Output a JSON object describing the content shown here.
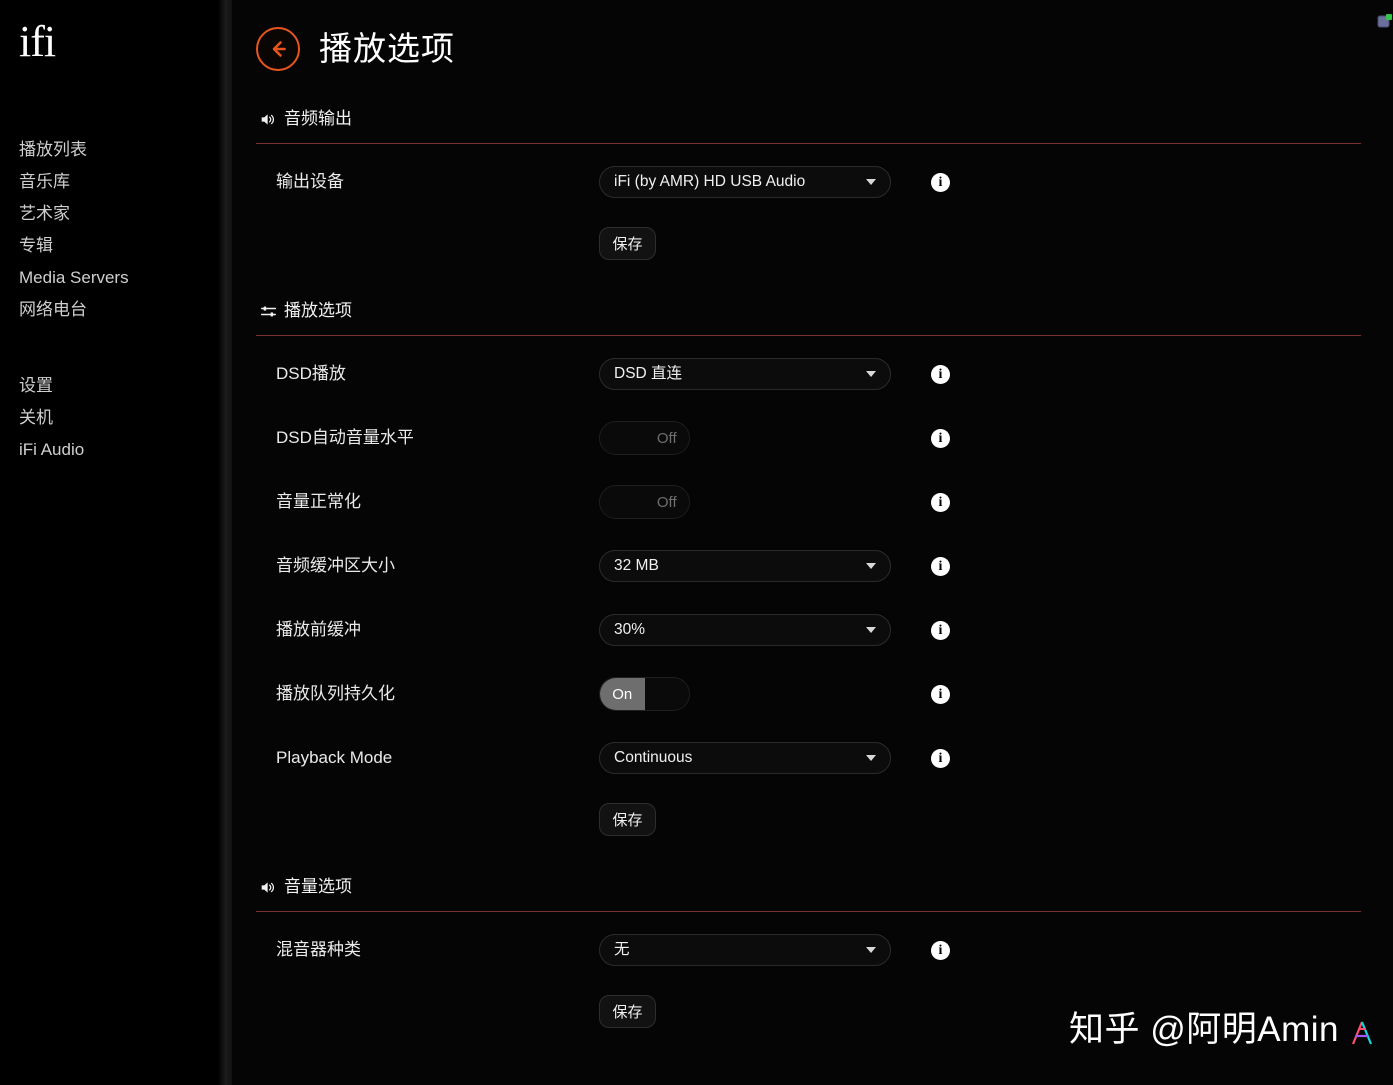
{
  "app": {
    "brand_logo_text": "ifi",
    "accent_color": "#e8551f",
    "rule_color": "#7a3128"
  },
  "sidebar": {
    "primary_items": [
      {
        "label": "播放列表",
        "name": "sidebar-item-playlists"
      },
      {
        "label": "音乐库",
        "name": "sidebar-item-library"
      },
      {
        "label": "艺术家",
        "name": "sidebar-item-artists"
      },
      {
        "label": "专辑",
        "name": "sidebar-item-albums"
      },
      {
        "label": "Media Servers",
        "name": "sidebar-item-media-servers"
      },
      {
        "label": "网络电台",
        "name": "sidebar-item-internet-radio"
      }
    ],
    "secondary_items": [
      {
        "label": "设置",
        "name": "sidebar-item-settings"
      },
      {
        "label": "关机",
        "name": "sidebar-item-shutdown"
      },
      {
        "label": "iFi Audio",
        "name": "sidebar-item-ifi-audio"
      }
    ]
  },
  "header": {
    "title": "播放选项",
    "back_icon": "arrow-left-icon"
  },
  "sections": [
    {
      "id": "audio-output",
      "icon": "speaker-icon",
      "title": "音频输出",
      "rows": [
        {
          "label": "输出设备",
          "control": "select",
          "value": "iFi (by AMR) HD USB Audio",
          "name": "output-device"
        }
      ],
      "save_label": "保存"
    },
    {
      "id": "playback-options",
      "icon": "sliders-icon",
      "title": "播放选项",
      "rows": [
        {
          "label": "DSD播放",
          "control": "select",
          "value": "DSD 直连",
          "name": "dsd-playback"
        },
        {
          "label": "DSD自动音量水平",
          "control": "toggle",
          "value": "Off",
          "state": "off",
          "name": "dsd-auto-volume-level"
        },
        {
          "label": "音量正常化",
          "control": "toggle",
          "value": "Off",
          "state": "off",
          "name": "volume-normalization"
        },
        {
          "label": "音频缓冲区大小",
          "control": "select",
          "value": "32 MB",
          "name": "audio-buffer-size"
        },
        {
          "label": "播放前缓冲",
          "control": "select",
          "value": "30%",
          "name": "pre-buffer"
        },
        {
          "label": "播放队列持久化",
          "control": "toggle",
          "value": "On",
          "state": "on",
          "name": "queue-persistence"
        },
        {
          "label": "Playback Mode",
          "control": "select",
          "value": "Continuous",
          "name": "playback-mode"
        }
      ],
      "save_label": "保存"
    },
    {
      "id": "volume-options",
      "icon": "speaker-icon",
      "title": "音量选项",
      "rows": [
        {
          "label": "混音器种类",
          "control": "select",
          "value": "无",
          "name": "mixer-type"
        }
      ],
      "save_label": "保存"
    }
  ],
  "watermark": {
    "text": "知乎 @阿明Amin"
  }
}
